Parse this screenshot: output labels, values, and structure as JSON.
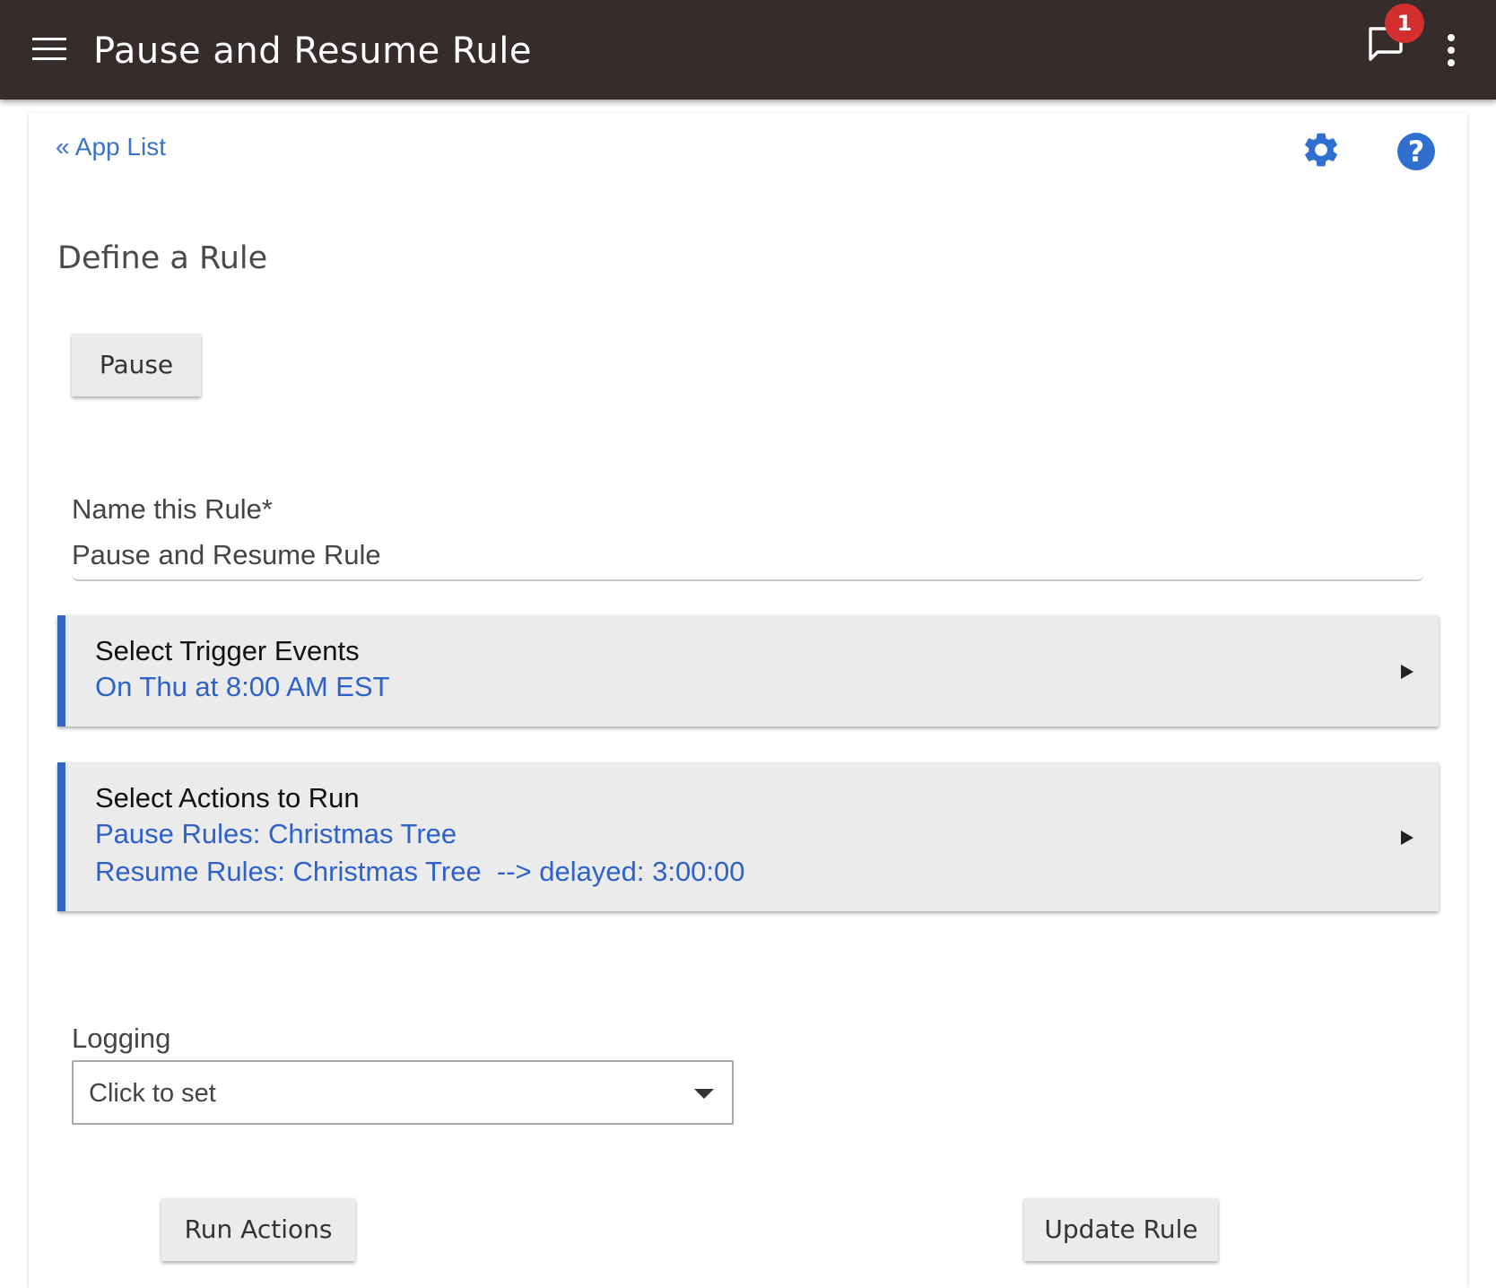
{
  "appbar": {
    "title": "Pause and Resume Rule",
    "notification_count": "1"
  },
  "nav": {
    "back_link": "« App List"
  },
  "page": {
    "heading": "Define a Rule",
    "pause_button": "Pause",
    "help_symbol": "?"
  },
  "name_field": {
    "label": "Name this Rule*",
    "value": "Pause and Resume Rule"
  },
  "trigger_section": {
    "title": "Select Trigger Events",
    "lines": [
      "On Thu at 8:00 AM EST"
    ]
  },
  "actions_section": {
    "title": "Select Actions to Run",
    "lines": [
      "Pause Rules: Christmas Tree",
      "Resume Rules: Christmas Tree  --> delayed: 3:00:00"
    ]
  },
  "logging": {
    "label": "Logging",
    "selected": "Click to set"
  },
  "footer": {
    "run_actions": "Run Actions",
    "update_rule": "Update Rule"
  },
  "colors": {
    "appbar_bg": "#352c2b",
    "accent_blue": "#3466c4",
    "link_blue": "#2f62c8",
    "badge_red": "#d32f2f"
  },
  "icons": [
    "menu-icon",
    "chat-bubble-icon",
    "more-vert-icon",
    "gear-icon",
    "help-icon",
    "play-arrow-icon",
    "chevron-down-icon"
  ]
}
